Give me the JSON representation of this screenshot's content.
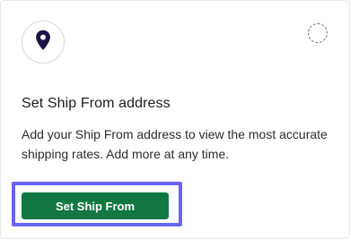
{
  "card": {
    "title": "Set Ship From address",
    "description": "Add your Ship From address to view the most accurate shipping rates. Add more at any time.",
    "button_label": "Set Ship From",
    "icon": "location-pin-icon",
    "status_indicator": "dashed-circle-icon"
  },
  "colors": {
    "button_bg": "#137741",
    "focus_ring": "#6a63f5",
    "pin": "#1b1446"
  }
}
